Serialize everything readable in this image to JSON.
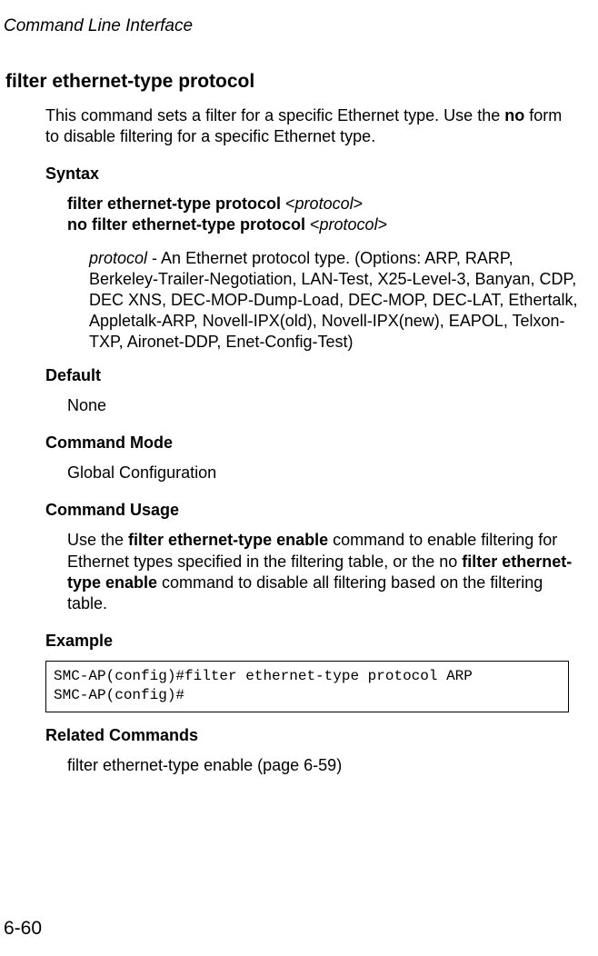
{
  "header": {
    "chapter": "Command Line Interface"
  },
  "command": {
    "title": "filter ethernet-type protocol",
    "intro_part1": "This command sets a filter for a specific Ethernet type. Use the ",
    "intro_part2_bold": "no",
    "intro_part3": " form to disable filtering for a specific Ethernet type."
  },
  "sections": {
    "syntax": {
      "heading": "Syntax",
      "line1_bold": "filter ethernet-type protocol ",
      "line1_lt": "<",
      "line1_param": "protocol",
      "line1_gt": ">",
      "line2_bold": "no filter ethernet-type protocol ",
      "line2_lt": "<",
      "line2_param": "protocol",
      "line2_gt": ">",
      "param_name": "protocol",
      "param_desc": " - An Ethernet protocol type. (Options: ARP, RARP, Berkeley-Trailer-Negotiation, LAN-Test, X25-Level-3, Banyan, CDP, DEC XNS, DEC-MOP-Dump-Load, DEC-MOP, DEC-LAT, Ethertalk, Appletalk-ARP, Novell-IPX(old), Novell-IPX(new), EAPOL, Telxon-TXP, Aironet-DDP, Enet-Config-Test)"
    },
    "default": {
      "heading": "Default",
      "value": "None"
    },
    "command_mode": {
      "heading": "Command Mode",
      "value": "Global Configuration"
    },
    "command_usage": {
      "heading": "Command Usage",
      "t1": "Use the ",
      "b1": "filter ethernet-type enable",
      "t2": " command to enable filtering for Ethernet types specified in the filtering table, or the no ",
      "b2": "filter ethernet-type enable",
      "t3": " command to disable all filtering based on the filtering table."
    },
    "example": {
      "heading": "Example",
      "line1": "SMC-AP(config)#filter ethernet-type protocol ARP",
      "line2": "SMC-AP(config)#"
    },
    "related": {
      "heading": "Related Commands",
      "text": "filter ethernet-type enable (page 6-59)"
    }
  },
  "footer": {
    "page_number": "6-60"
  }
}
